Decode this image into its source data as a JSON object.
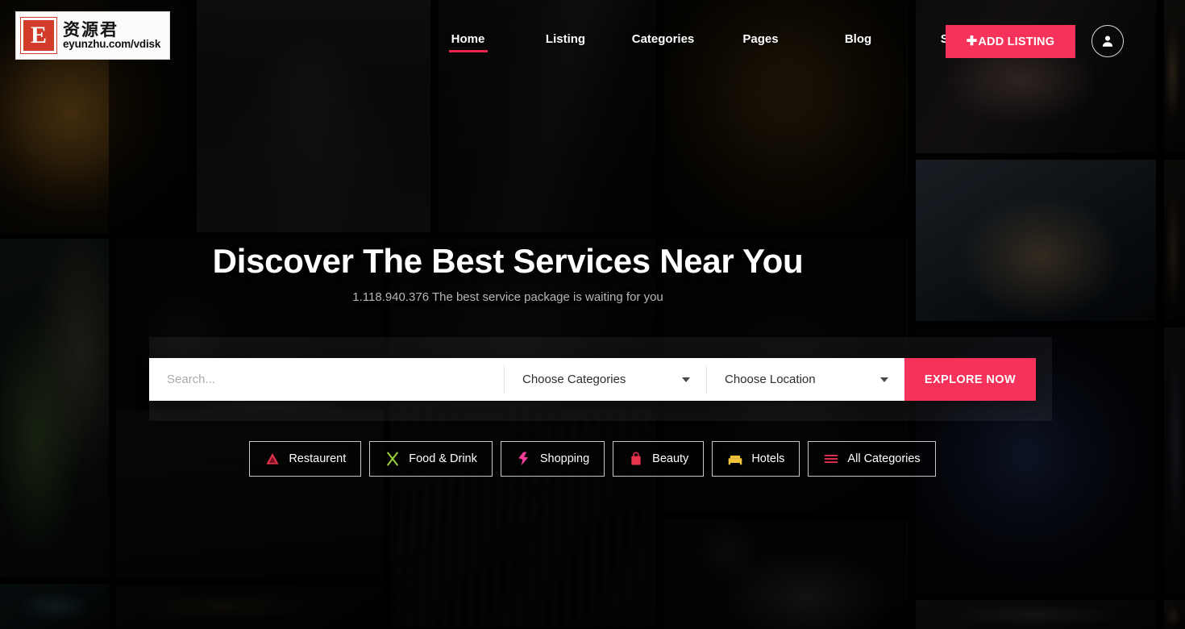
{
  "site": {
    "logo": {
      "mark_letter": "E",
      "chinese_name": "资源君",
      "url_text": "eyunzhu.com/vdisk"
    },
    "accent_color": "#f4325a",
    "nav_active_underline_color": "#e9254e"
  },
  "header": {
    "nav": [
      {
        "label": "Home",
        "name": "nav-home",
        "active": true
      },
      {
        "label": "Listing",
        "name": "nav-listing",
        "active": false
      },
      {
        "label": "Categories",
        "name": "nav-categories",
        "active": false
      },
      {
        "label": "Pages",
        "name": "nav-pages",
        "active": false
      },
      {
        "label": "Blog",
        "name": "nav-blog",
        "active": false
      },
      {
        "label": "Shop",
        "name": "nav-shop",
        "active": false
      }
    ],
    "add_listing_label": "ADD LISTING",
    "add_listing_plus": "✚",
    "account_icon": "user-icon"
  },
  "hero": {
    "title": "Discover The Best Services Near You",
    "subtitle": "1.118.940.376 The best service package is waiting for you"
  },
  "search": {
    "input_placeholder": "Search...",
    "input_value": "",
    "category_select": {
      "selected": "Choose Categories",
      "icon": "chevron-down-icon"
    },
    "location_select": {
      "selected": "Choose Location",
      "icon": "chevron-down-icon"
    },
    "submit_label": "EXPLORE NOW"
  },
  "categories": [
    {
      "label": "Restaurent",
      "icon": "restaurant-icon",
      "color": "#e8334f"
    },
    {
      "label": "Food & Drink",
      "icon": "fork-knife-icon",
      "color": "#9ad23a"
    },
    {
      "label": "Shopping",
      "icon": "shopping-tag-icon",
      "color": "#f23d9a"
    },
    {
      "label": "Beauty",
      "icon": "handbag-icon",
      "color": "#e8334f"
    },
    {
      "label": "Hotels",
      "icon": "bed-icon",
      "color": "#f0c33a"
    },
    {
      "label": "All Categories",
      "icon": "hamburger-list-icon",
      "color": "#f4325a"
    }
  ]
}
